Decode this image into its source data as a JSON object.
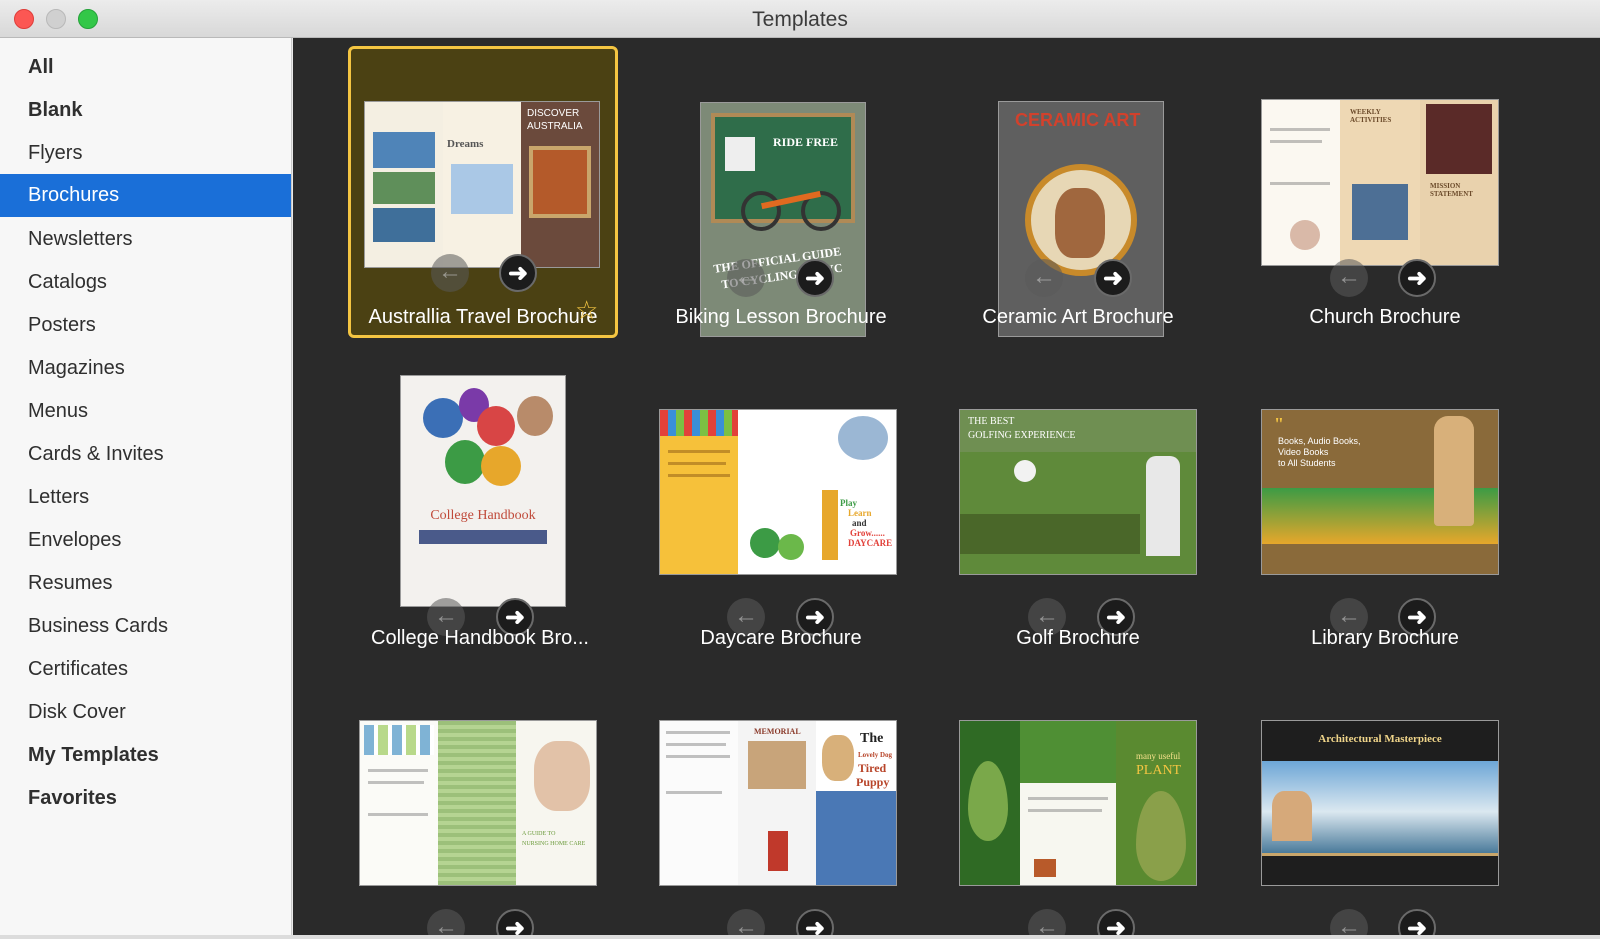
{
  "window": {
    "title": "Templates"
  },
  "sidebar": {
    "items": [
      {
        "label": "All"
      },
      {
        "label": "Blank"
      },
      {
        "label": "Flyers"
      },
      {
        "label": "Brochures"
      },
      {
        "label": "Newsletters"
      },
      {
        "label": "Catalogs"
      },
      {
        "label": "Posters"
      },
      {
        "label": "Magazines"
      },
      {
        "label": "Menus"
      },
      {
        "label": "Cards & Invites"
      },
      {
        "label": "Letters"
      },
      {
        "label": "Envelopes"
      },
      {
        "label": "Resumes"
      },
      {
        "label": "Business Cards"
      },
      {
        "label": "Certificates"
      },
      {
        "label": "Disk Cover"
      },
      {
        "label": "My Templates"
      },
      {
        "label": "Favorites"
      }
    ],
    "selected": "Brochures"
  },
  "templates": [
    {
      "label": "Australlia Travel Brochure",
      "selected": true,
      "favorite": true,
      "thumb_text": [
        "DISCOVER",
        "AUSTRALIA",
        "Dreams"
      ]
    },
    {
      "label": "Biking Lesson Brochure",
      "thumb_text": [
        "RIDE FREE",
        "THE OFFICIAL GUIDE",
        "TO CYCLING IN NYC"
      ]
    },
    {
      "label": "Ceramic Art Brochure",
      "thumb_text": [
        "CERAMIC ART"
      ]
    },
    {
      "label": "Church Brochure",
      "thumb_text": [
        "WEEKLY ACTIVITIES",
        "MISSION STATEMENT"
      ]
    },
    {
      "label": "College Handbook Bro...",
      "thumb_text": [
        "College Handbook"
      ]
    },
    {
      "label": "Daycare Brochure",
      "thumb_text": [
        "Play",
        "Learn",
        "and",
        "Grow......",
        "DAYCARE"
      ]
    },
    {
      "label": "Golf Brochure",
      "thumb_text": [
        "THE BEST",
        "GOLFING EXPERIENCE"
      ]
    },
    {
      "label": "Library Brochure",
      "thumb_text": [
        "Books, Audio Books,",
        "Video Books",
        "to All Students"
      ]
    },
    {
      "label": "",
      "thumb_text": [
        "A GUIDE TO",
        "NURSING HOME CARE"
      ]
    },
    {
      "label": "",
      "thumb_text": [
        "MEMORIAL",
        "The",
        "Lovely Dog",
        "Tired",
        "Puppy"
      ]
    },
    {
      "label": "",
      "thumb_text": [
        "many useful",
        "PLANT"
      ]
    },
    {
      "label": "",
      "thumb_text": [
        "Architectural Masterpiece"
      ]
    }
  ],
  "icons": {
    "prev": "←",
    "next": "➜",
    "favorite": "☆"
  },
  "colors": {
    "accent": "#1a6fd8",
    "selection": "#f4c542",
    "content_bg": "#2a2a2a"
  }
}
